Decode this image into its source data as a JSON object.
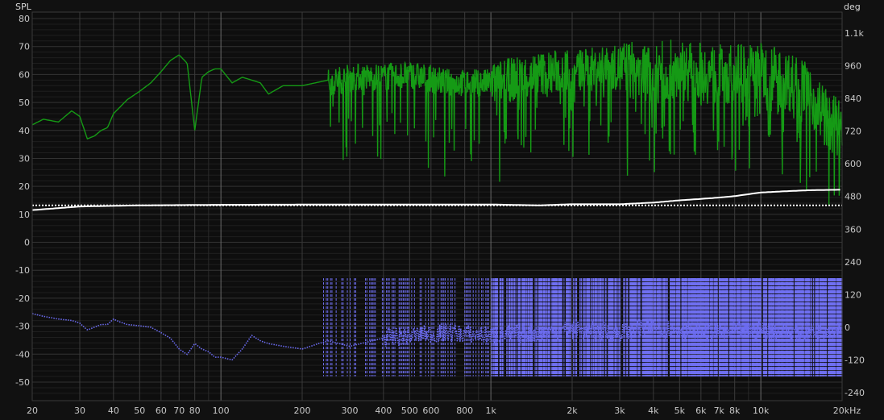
{
  "chart_data": {
    "type": "line",
    "x_scale": "log",
    "xlim": [
      20,
      20000
    ],
    "ylim_left": [
      -55,
      80
    ],
    "ylim_right": [
      -250,
      1170
    ],
    "ylabel_left": "SPL",
    "ylabel_right": "deg",
    "grid": true,
    "x_ticks": [
      {
        "v": 20,
        "label": "20"
      },
      {
        "v": 30,
        "label": "30"
      },
      {
        "v": 40,
        "label": "40"
      },
      {
        "v": 50,
        "label": "50"
      },
      {
        "v": 60,
        "label": "60"
      },
      {
        "v": 70,
        "label": "70"
      },
      {
        "v": 80,
        "label": "80"
      },
      {
        "v": 100,
        "label": "100"
      },
      {
        "v": 200,
        "label": "200"
      },
      {
        "v": 300,
        "label": "300"
      },
      {
        "v": 400,
        "label": "400"
      },
      {
        "v": 500,
        "label": "500"
      },
      {
        "v": 600,
        "label": "600"
      },
      {
        "v": 800,
        "label": "800"
      },
      {
        "v": 1000,
        "label": "1k"
      },
      {
        "v": 2000,
        "label": "2k"
      },
      {
        "v": 3000,
        "label": "3k"
      },
      {
        "v": 4000,
        "label": "4k"
      },
      {
        "v": 5000,
        "label": "5k"
      },
      {
        "v": 6000,
        "label": "6k"
      },
      {
        "v": 7000,
        "label": "7k"
      },
      {
        "v": 8000,
        "label": "8k"
      },
      {
        "v": 10000,
        "label": "10k"
      },
      {
        "v": 20000,
        "label": "20kHz"
      }
    ],
    "y_ticks_left": [
      80,
      70,
      60,
      50,
      40,
      30,
      20,
      10,
      0,
      -10,
      -20,
      -30,
      -40,
      -50
    ],
    "y_ticks_right": [
      {
        "v": 1080,
        "label": "1.1k"
      },
      {
        "v": 960,
        "label": "960"
      },
      {
        "v": 840,
        "label": "840"
      },
      {
        "v": 720,
        "label": "720"
      },
      {
        "v": 600,
        "label": "600"
      },
      {
        "v": 480,
        "label": "480"
      },
      {
        "v": 360,
        "label": "360"
      },
      {
        "v": 240,
        "label": "240"
      },
      {
        "v": 120,
        "label": "120"
      },
      {
        "v": 0,
        "label": "0"
      },
      {
        "v": -120,
        "label": "-120"
      },
      {
        "v": -240,
        "label": "-240"
      }
    ],
    "series": [
      {
        "axis": "left",
        "color": "#159a15",
        "style": "solid",
        "x": [
          20,
          22,
          25,
          28,
          30,
          32,
          34,
          36,
          38,
          40,
          45,
          50,
          55,
          60,
          65,
          70,
          75,
          80,
          85,
          90,
          95,
          100,
          110,
          120,
          130,
          140,
          150,
          170,
          200,
          250,
          300,
          400,
          500,
          700,
          1000,
          1500,
          2000,
          3000,
          4000,
          5000,
          7000,
          10000,
          12000,
          14000,
          16000,
          18000,
          20000
        ],
        "values": [
          42,
          44,
          43,
          47,
          45,
          37,
          38,
          40,
          41,
          46,
          51,
          54,
          57,
          61,
          65,
          67,
          64,
          40,
          59,
          61,
          62,
          62,
          57,
          59,
          58,
          57,
          53,
          56,
          56,
          58,
          60,
          60,
          61,
          58,
          58,
          62,
          63,
          64,
          63,
          64,
          62,
          63,
          61,
          58,
          52,
          45,
          42
        ]
      },
      {
        "axis": "left",
        "color": "#ffffff",
        "style": "solid",
        "x": [
          20,
          30,
          50,
          100,
          300,
          1000,
          1500,
          2000,
          3000,
          4000,
          5000,
          6000,
          7000,
          8000,
          9000,
          10000,
          12000,
          15000,
          20000
        ],
        "values": [
          11.5,
          12.8,
          13.2,
          13.4,
          13.5,
          13.5,
          13.2,
          13.6,
          13.6,
          14.2,
          15,
          15.5,
          16,
          16.5,
          17.2,
          17.8,
          18.2,
          18.6,
          18.8
        ]
      },
      {
        "axis": "left",
        "color": "#ffffff",
        "style": "dotted",
        "x": [
          20,
          20000
        ],
        "values": [
          13.2,
          13.2
        ]
      },
      {
        "axis": "right",
        "color": "#6b6bf0",
        "style": "dotted",
        "x": [
          20,
          22,
          25,
          28,
          30,
          32,
          34,
          36,
          38,
          40,
          42,
          45,
          50,
          55,
          60,
          65,
          70,
          75,
          80,
          85,
          90,
          95,
          100,
          110,
          120,
          130,
          140,
          150,
          170,
          200,
          230,
          250,
          300,
          400,
          500,
          700,
          1000,
          1500,
          2000,
          3000,
          4000,
          5000,
          7000,
          10000,
          14000,
          20000
        ],
        "values": [
          50,
          40,
          30,
          25,
          15,
          -10,
          0,
          10,
          10,
          30,
          20,
          10,
          5,
          0,
          -20,
          -40,
          -80,
          -100,
          -60,
          -80,
          -90,
          -110,
          -110,
          -120,
          -80,
          -30,
          -50,
          -60,
          -70,
          -80,
          -60,
          -50,
          -70,
          -40,
          -30,
          -20,
          -30,
          -20,
          -10,
          -20,
          0,
          -10,
          -20,
          -10,
          -20,
          0
        ]
      }
    ],
    "band_colors": {
      "magnitude": "#159a15",
      "phase": "#7070f2"
    }
  }
}
